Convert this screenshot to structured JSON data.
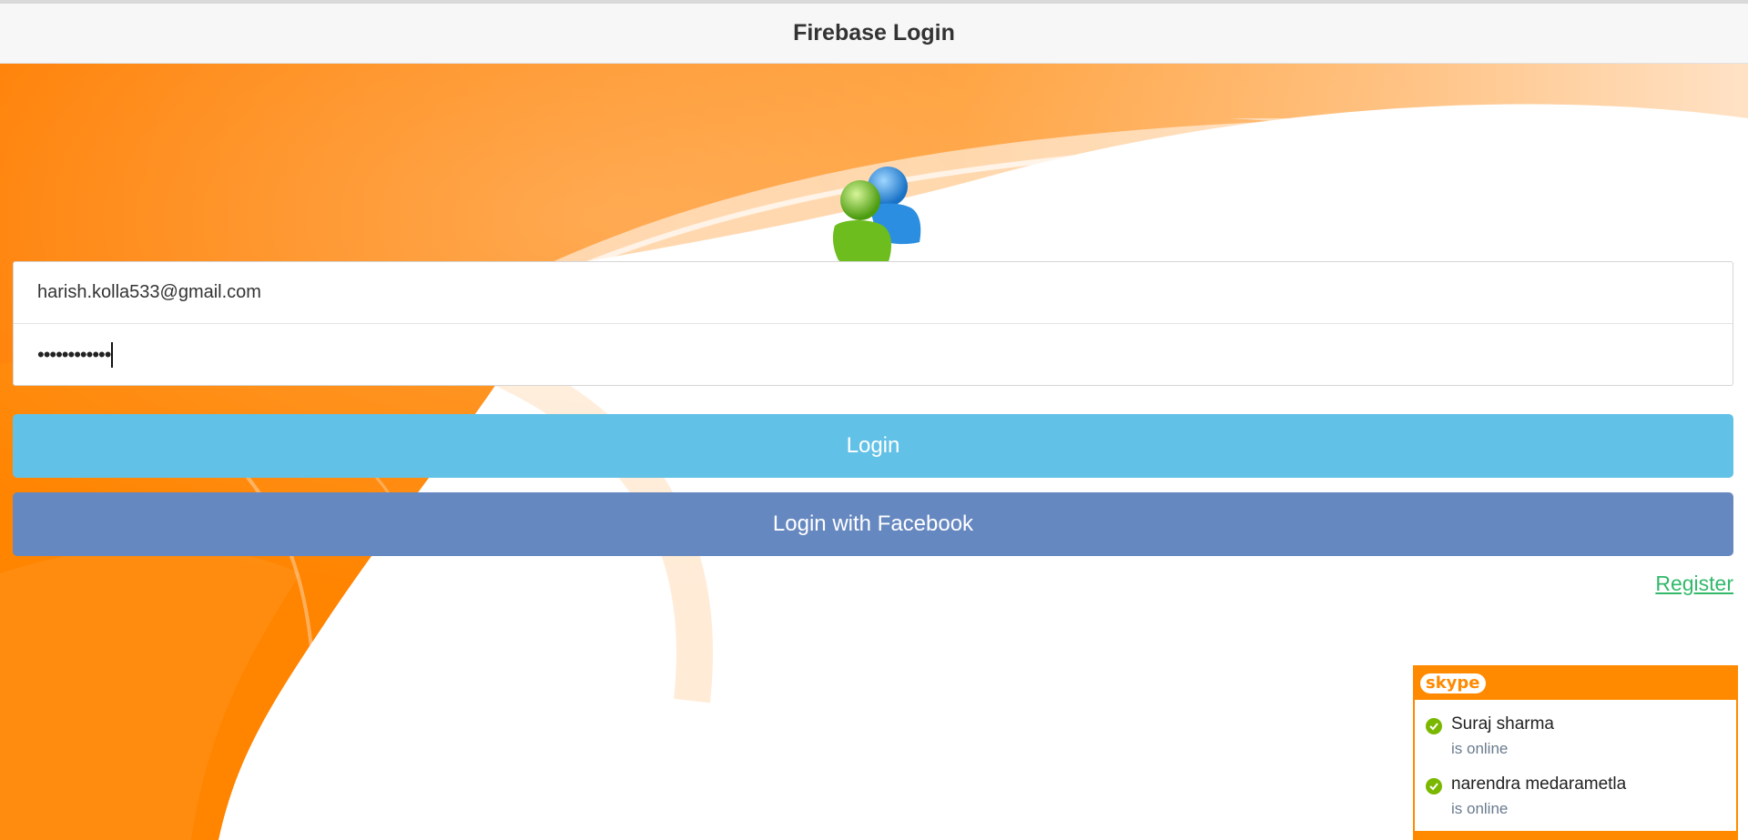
{
  "header": {
    "title": "Firebase Login"
  },
  "login_form": {
    "email_value": "harish.kolla533@gmail.com",
    "password_masked": "••••••••••••"
  },
  "buttons": {
    "login_label": "Login",
    "facebook_label": "Login with Facebook"
  },
  "links": {
    "register_label": "Register"
  },
  "skype": {
    "logo_text": "skype",
    "contacts": [
      {
        "name": "Suraj sharma",
        "status": "is online"
      },
      {
        "name": "narendra medarametla",
        "status": "is online"
      }
    ]
  },
  "colors": {
    "brand_orange": "#ff8a00",
    "login_button": "#62c1e6",
    "facebook_button": "#6688c0",
    "register_link": "#33b96b",
    "online_status": "#7ab800"
  },
  "icons": {
    "logo": "users-icon",
    "online": "check-circle-icon"
  }
}
